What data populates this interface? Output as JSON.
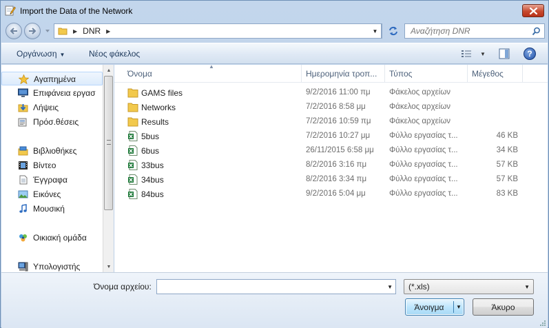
{
  "window": {
    "title": "Import the Data of the Network"
  },
  "address": {
    "crumb": "DNR",
    "search_placeholder": "Αναζήτηση DNR"
  },
  "toolbar": {
    "organize": "Οργάνωση",
    "new_folder": "Νέος φάκελος",
    "help": "?"
  },
  "nav": {
    "items": [
      {
        "label": "Αγαπημένα",
        "icon": "star-icon"
      },
      {
        "label": "Επιφάνεια εργασ",
        "icon": "desktop-icon"
      },
      {
        "label": "Λήψεις",
        "icon": "downloads-icon"
      },
      {
        "label": "Πρόσ.θέσεις",
        "icon": "recent-places-icon"
      },
      {
        "label": "Βιβλιοθήκες",
        "icon": "libraries-icon"
      },
      {
        "label": "Βίντεο",
        "icon": "video-icon"
      },
      {
        "label": "Έγγραφα",
        "icon": "documents-icon"
      },
      {
        "label": "Εικόνες",
        "icon": "pictures-icon"
      },
      {
        "label": "Μουσική",
        "icon": "music-icon"
      },
      {
        "label": "Οικιακή ομάδα",
        "icon": "homegroup-icon"
      },
      {
        "label": "Υπολογιστής",
        "icon": "computer-icon"
      }
    ]
  },
  "columns": {
    "name": "Όνομα",
    "date": "Ημερομηνία τροπ...",
    "type": "Τύπος",
    "size": "Μέγεθος"
  },
  "files": [
    {
      "name": "GAMS files",
      "date": "9/2/2016 11:00 πμ",
      "type": "Φάκελος αρχείων",
      "size": ""
    },
    {
      "name": "Networks",
      "date": "7/2/2016 8:58 μμ",
      "type": "Φάκελος αρχείων",
      "size": ""
    },
    {
      "name": "Results",
      "date": "7/2/2016 10:59 πμ",
      "type": "Φάκελος αρχείων",
      "size": ""
    },
    {
      "name": "5bus",
      "date": "7/2/2016 10:27 μμ",
      "type": "Φύλλο εργασίας τ...",
      "size": "46 KB"
    },
    {
      "name": "6bus",
      "date": "26/11/2015 6:58 μμ",
      "type": "Φύλλο εργασίας τ...",
      "size": "34 KB"
    },
    {
      "name": "33bus",
      "date": "8/2/2016 3:16 πμ",
      "type": "Φύλλο εργασίας τ...",
      "size": "57 KB"
    },
    {
      "name": "34bus",
      "date": "8/2/2016 3:34 πμ",
      "type": "Φύλλο εργασίας τ...",
      "size": "57 KB"
    },
    {
      "name": "84bus",
      "date": "9/2/2016 5:04 μμ",
      "type": "Φύλλο εργασίας τ...",
      "size": "83 KB"
    }
  ],
  "bottom": {
    "filename_label": "Όνομα αρχείου:",
    "filename_value": "",
    "filter": "(*.xls)",
    "open": "Άνοιγμα",
    "cancel": "Άκυρο"
  }
}
